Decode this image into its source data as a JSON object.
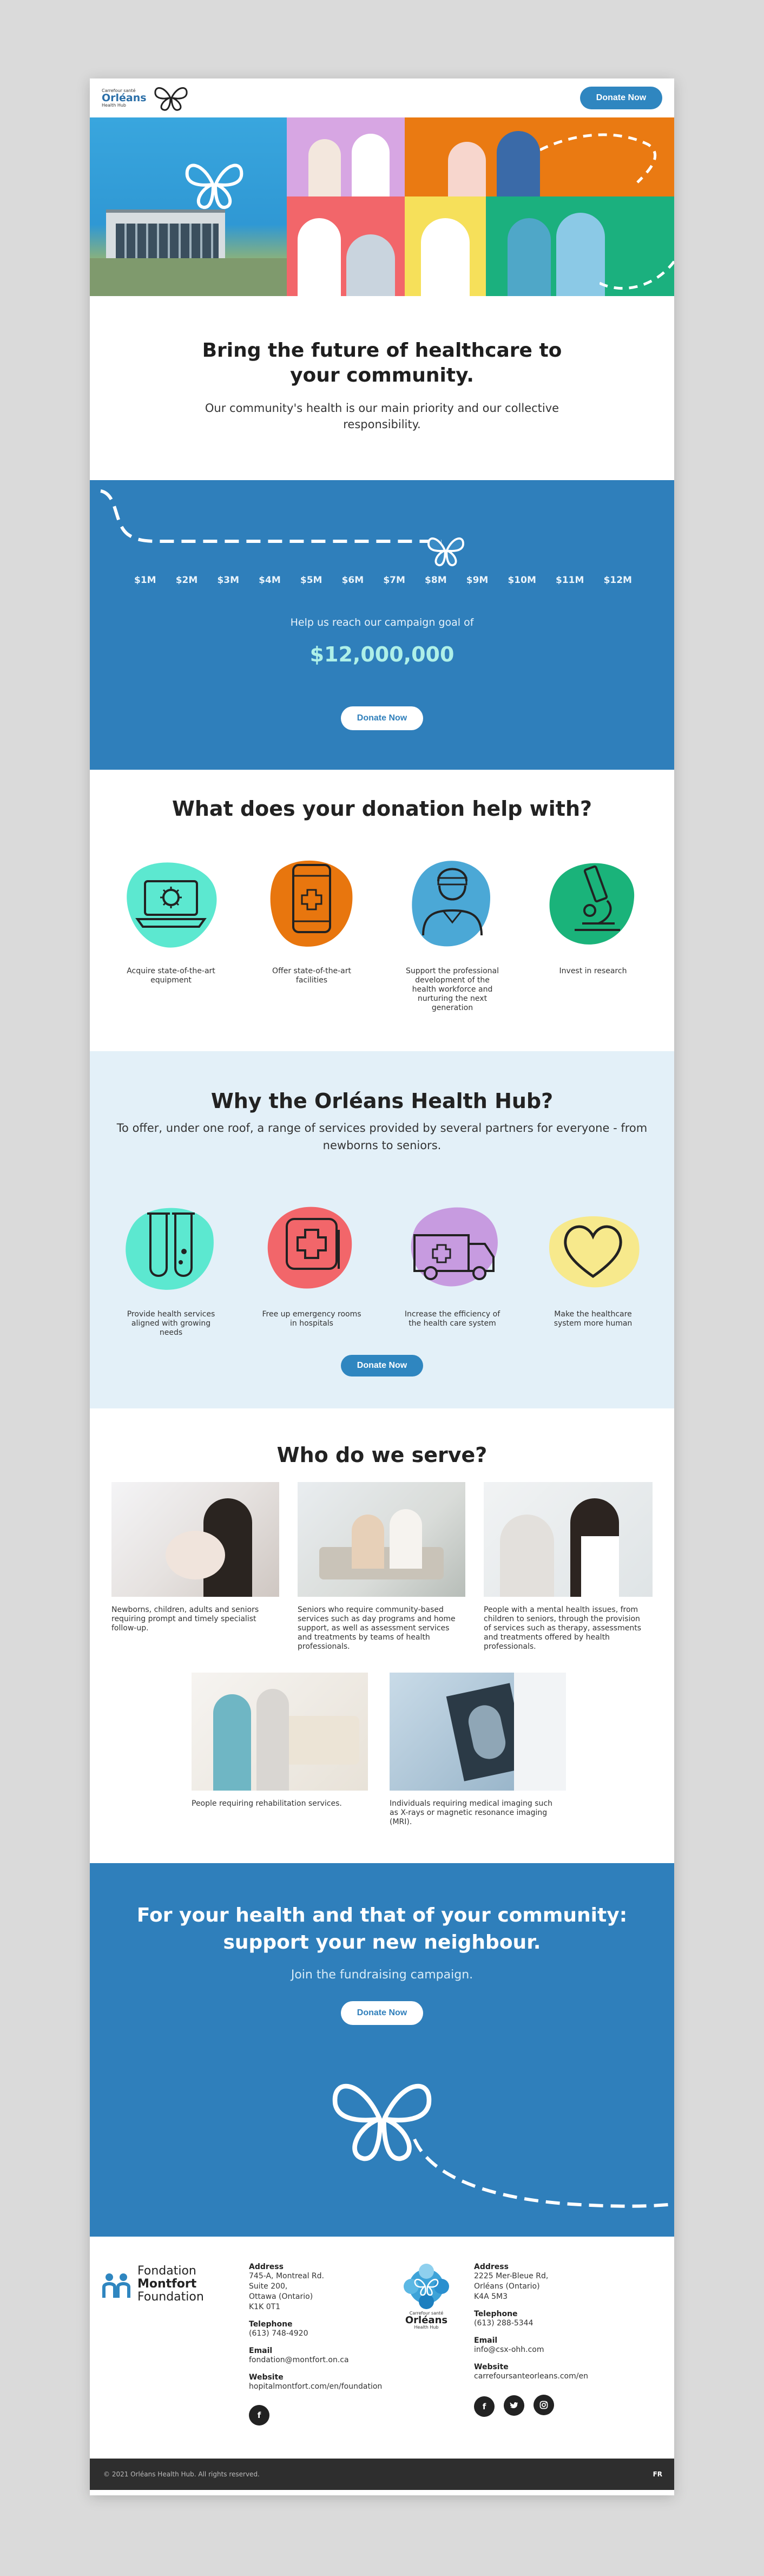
{
  "header": {
    "logo_small": "Carrefour santé",
    "logo_big": "Orléans",
    "logo_sub": "Health Hub",
    "donate_label": "Donate Now"
  },
  "intro": {
    "title": "Bring the future of healthcare to your community.",
    "subtitle": "Our community's health is our main priority and our collective responsibility."
  },
  "campaign": {
    "scale": [
      "$1M",
      "$2M",
      "$3M",
      "$4M",
      "$5M",
      "$6M",
      "$7M",
      "$8M",
      "$9M",
      "$10M",
      "$11M",
      "$12M"
    ],
    "progress_millions": 8,
    "goal_text": "Help us reach our campaign goal of",
    "goal_value": "$12,000,000",
    "donate_label": "Donate Now"
  },
  "help": {
    "title": "What does your donation help with?",
    "items": [
      {
        "label": "Acquire state-of-the-art equipment",
        "icon": "laptop-virus-icon",
        "color": "#5ce8d0"
      },
      {
        "label": "Offer state-of-the-art facilities",
        "icon": "tablet-medical-icon",
        "color": "#e8760e"
      },
      {
        "label": "Support the professional development of the health workforce and nurturing the next generation",
        "icon": "doctor-icon",
        "color": "#4ba8d6"
      },
      {
        "label": "Invest in research",
        "icon": "microscope-icon",
        "color": "#1ab37a"
      }
    ]
  },
  "why": {
    "title": "Why the Orléans Health Hub?",
    "lead": "To offer, under one roof, a range of services provided by several partners for everyone - from newborns to seniors.",
    "items": [
      {
        "label": "Provide health services aligned with growing needs",
        "icon": "test-tubes-icon",
        "color": "#5ce8d0"
      },
      {
        "label": "Free up emergency rooms in hospitals",
        "icon": "hospital-sign-icon",
        "color": "#f2666a"
      },
      {
        "label": "Increase the efficiency of the health care system",
        "icon": "ambulance-icon",
        "color": "#c79be0"
      },
      {
        "label": "Make the healthcare system more human",
        "icon": "heart-icon",
        "color": "#f7e98c"
      }
    ],
    "donate_label": "Donate Now"
  },
  "serve": {
    "title": "Who do we serve?",
    "groups": [
      "Newborns, children, adults and seniors requiring prompt and timely specialist follow-up.",
      "Seniors who require community-based services such as day programs and home support, as well as assessment services and treatments by teams of health professionals.",
      "People with a mental health issues, from children to seniors, through the provision of services such as therapy, assessments and treatments offered by health professionals.",
      "People requiring rehabilitation services.",
      "Individuals requiring medical imaging such as X-rays or magnetic resonance imaging (MRI)."
    ]
  },
  "cta": {
    "title": "For your health and that of your community: support your new neighbour.",
    "subtitle": "Join the fundraising campaign.",
    "donate_label": "Donate Now"
  },
  "footer": {
    "foundation": {
      "logo": [
        "Fondation",
        "Montfort",
        "Foundation"
      ],
      "address_label": "Address",
      "address": [
        "745-A, Montreal Rd.",
        "Suite 200,",
        "Ottawa (Ontario)",
        "K1K 0T1"
      ],
      "phone_label": "Telephone",
      "phone": "(613) 748-4920",
      "email_label": "Email",
      "email": "fondation@montfort.on.ca",
      "website_label": "Website",
      "website": "hopitalmontfort.com/en/foundation"
    },
    "hub": {
      "logo_small": "Carrefour santé",
      "logo_big": "Orléans",
      "logo_sub": "Health Hub",
      "address_label": "Address",
      "address": [
        "2225 Mer-Bleue Rd,",
        "Orléans (Ontario)",
        "K4A 5M3"
      ],
      "phone_label": "Telephone",
      "phone": "(613) 288-5344",
      "email_label": "Email",
      "email": "info@csx-ohh.com",
      "website_label": "Website",
      "website": "carrefoursanteorleans.com/en"
    },
    "copyright": "© 2021 Orléans Health Hub. All rights reserved.",
    "language": "FR"
  },
  "colors": {
    "primary_blue": "#2f7fbb",
    "button_blue": "#2f86c0",
    "light_blue": "#e3f0f8",
    "goal_teal": "#aef0e8",
    "footer_dark": "#2e2e2e"
  }
}
